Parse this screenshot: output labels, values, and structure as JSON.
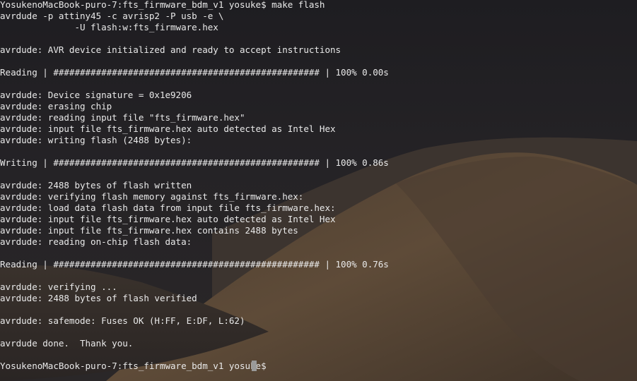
{
  "wallpaper": {
    "sky_color": "#1f1e22",
    "dune_color": "#5a4a38",
    "shadow_color": "#2d2a2c"
  },
  "terminal": {
    "text_color": "#e9e9e9",
    "cursor_color": "#9a9a9a",
    "lines": [
      "YosukenoMacBook-puro-7:fts_firmware_bdm_v1 yosuke$ make flash",
      "avrdude -p attiny45 -c avrisp2 -P usb -e \\",
      "              -U flash:w:fts_firmware.hex",
      "",
      "avrdude: AVR device initialized and ready to accept instructions",
      "",
      "Reading | ################################################## | 100% 0.00s",
      "",
      "avrdude: Device signature = 0x1e9206",
      "avrdude: erasing chip",
      "avrdude: reading input file \"fts_firmware.hex\"",
      "avrdude: input file fts_firmware.hex auto detected as Intel Hex",
      "avrdude: writing flash (2488 bytes):",
      "",
      "Writing | ################################################## | 100% 0.86s",
      "",
      "avrdude: 2488 bytes of flash written",
      "avrdude: verifying flash memory against fts_firmware.hex:",
      "avrdude: load data flash data from input file fts_firmware.hex:",
      "avrdude: input file fts_firmware.hex auto detected as Intel Hex",
      "avrdude: input file fts_firmware.hex contains 2488 bytes",
      "avrdude: reading on-chip flash data:",
      "",
      "Reading | ################################################## | 100% 0.76s",
      "",
      "avrdude: verifying ...",
      "avrdude: 2488 bytes of flash verified",
      "",
      "avrdude: safemode: Fuses OK (H:FF, E:DF, L:62)",
      "",
      "avrdude done.  Thank you.",
      "",
      "YosukenoMacBook-puro-7:fts_firmware_bdm_v1 yosuke$ "
    ]
  }
}
